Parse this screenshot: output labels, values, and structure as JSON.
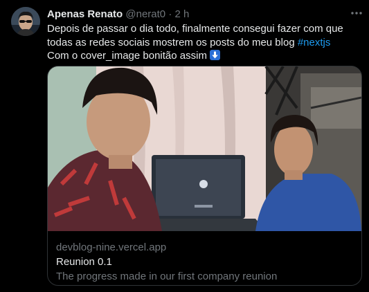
{
  "tweet": {
    "author": {
      "display_name": "Apenas Renato",
      "handle": "@nerat0",
      "separator": "·",
      "time": "2 h"
    },
    "text_parts": {
      "before": "Depois de passar o dia todo, finalmente consegui fazer com que todas as redes sociais mostrem os posts do meu blog ",
      "hashtag": "#nextjs",
      "after": " Com o cover_image bonitão assim "
    },
    "emoji": "down-arrow-emoji-icon",
    "card": {
      "domain": "devblog-nine.vercel.app",
      "title": "Reunion 0.1",
      "description": "The progress made in our first company reunion"
    }
  },
  "colors": {
    "background": "#000000",
    "text": "#e7e9ea",
    "muted": "#71767b",
    "link": "#1d9bf0",
    "border": "#2f3336"
  }
}
